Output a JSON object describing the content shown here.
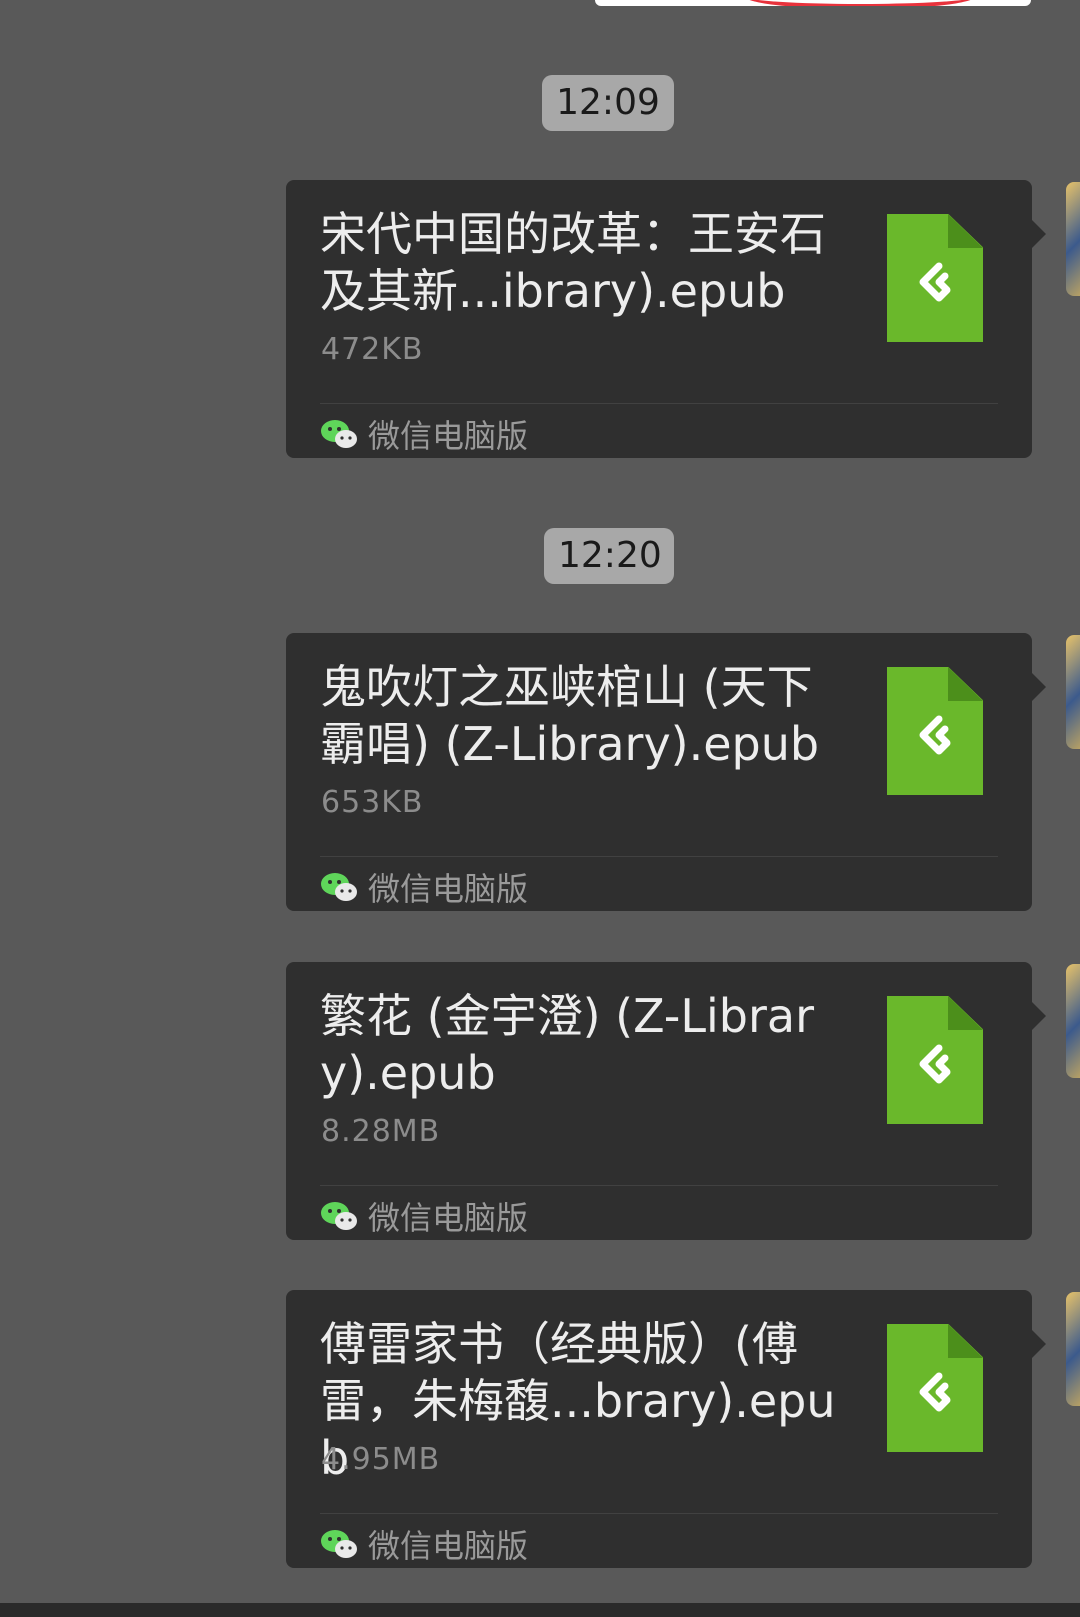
{
  "timestamps": [
    "12:09",
    "12:20"
  ],
  "messages": [
    {
      "file_name": "宋代中国的改革：王安石及其新...ibrary).epub",
      "file_size": "472KB",
      "source": "微信电脑版",
      "file_icon": "epub-file-icon"
    },
    {
      "file_name": "鬼吹灯之巫峡棺山 (天下霸唱) (Z-Library).epub",
      "file_size": "653KB",
      "source": "微信电脑版",
      "file_icon": "epub-file-icon"
    },
    {
      "file_name": "繁花 (金宇澄) (Z-Library).epub",
      "file_size": "8.28MB",
      "source": "微信电脑版",
      "file_icon": "epub-file-icon"
    },
    {
      "file_name": "傅雷家书（经典版）(傅雷，朱梅馥...brary).epub",
      "file_size": "4.95MB",
      "source": "微信电脑版",
      "file_icon": "epub-file-icon"
    }
  ],
  "colors": {
    "background": "#595959",
    "bubble": "#2f2f2f",
    "epub_green": "#6ab82b",
    "timestamp_bg": "#a8a8a8",
    "wechat_green": "#5fd55a"
  }
}
